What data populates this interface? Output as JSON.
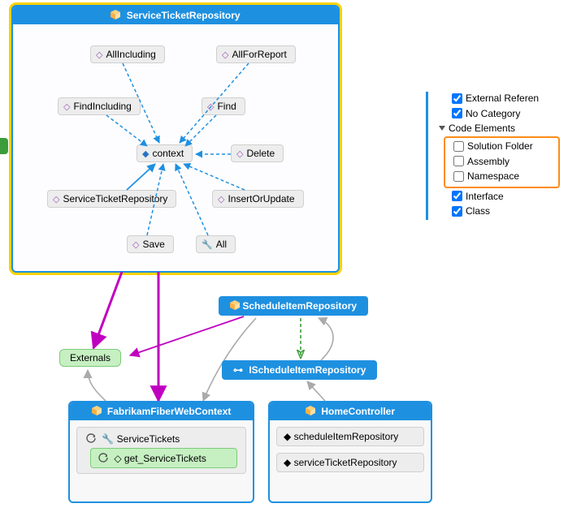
{
  "repo_main": {
    "title": "ServiceTicketRepository",
    "nodes": {
      "allIncluding": "AllIncluding",
      "allForReport": "AllForReport",
      "findIncluding": "FindIncluding",
      "find": "Find",
      "context": "context",
      "delete": "Delete",
      "serviceTicketRepository": "ServiceTicketRepository",
      "insertOrUpdate": "InsertOrUpdate",
      "save": "Save",
      "all": "All"
    }
  },
  "externals": "Externals",
  "schedule_repo": "ScheduleItemRepository",
  "ischedule_repo": "IScheduleItemRepository",
  "fabrikam": {
    "title": "FabrikamFiberWebContext",
    "serviceTickets": "ServiceTickets",
    "getServiceTickets": "get_ServiceTickets"
  },
  "home": {
    "title": "HomeController",
    "scheduleItemRepository": "scheduleItemRepository",
    "serviceTicketRepository": "serviceTicketRepository"
  },
  "legend": {
    "externalReferences": "External Referen",
    "noCategory": "No Category",
    "heading": "Code Elements",
    "solutionFolder": "Solution Folder",
    "assembly": "Assembly",
    "namespace": "Namespace",
    "interface": "Interface",
    "class": "Class"
  },
  "chart_data": {
    "type": "diagram",
    "title": "Code Map / Dependency Graph",
    "nodes": [
      {
        "id": "ServiceTicketRepository",
        "kind": "class-container",
        "selected": true,
        "members": [
          "AllIncluding",
          "AllForReport",
          "FindIncluding",
          "Find",
          "context",
          "Delete",
          "ServiceTicketRepository",
          "InsertOrUpdate",
          "Save",
          "All"
        ]
      },
      {
        "id": "Externals",
        "kind": "external-group"
      },
      {
        "id": "ScheduleItemRepository",
        "kind": "class"
      },
      {
        "id": "IScheduleItemRepository",
        "kind": "interface"
      },
      {
        "id": "FabrikamFiberWebContext",
        "kind": "class-container",
        "members": [
          "ServiceTickets",
          "get_ServiceTickets"
        ]
      },
      {
        "id": "HomeController",
        "kind": "class-container",
        "members": [
          "scheduleItemRepository",
          "serviceTicketRepository"
        ]
      }
    ],
    "edges": [
      {
        "from": "AllIncluding",
        "to": "context",
        "style": "dashed",
        "color": "#1E90E0"
      },
      {
        "from": "AllForReport",
        "to": "context",
        "style": "dashed",
        "color": "#1E90E0"
      },
      {
        "from": "FindIncluding",
        "to": "context",
        "style": "dashed",
        "color": "#1E90E0"
      },
      {
        "from": "Find",
        "to": "context",
        "style": "dashed",
        "color": "#1E90E0"
      },
      {
        "from": "Delete",
        "to": "context",
        "style": "dashed",
        "color": "#1E90E0"
      },
      {
        "from": "ServiceTicketRepository",
        "to": "context",
        "style": "solid",
        "color": "#1E90E0"
      },
      {
        "from": "InsertOrUpdate",
        "to": "context",
        "style": "dashed",
        "color": "#1E90E0"
      },
      {
        "from": "Save",
        "to": "context",
        "style": "dashed",
        "color": "#1E90E0"
      },
      {
        "from": "All",
        "to": "context",
        "style": "dashed",
        "color": "#1E90E0"
      },
      {
        "from": "ServiceTicketRepository",
        "to": "Externals",
        "style": "solid",
        "color": "#C000C0"
      },
      {
        "from": "ServiceTicketRepository",
        "to": "FabrikamFiberWebContext",
        "style": "solid",
        "color": "#C000C0"
      },
      {
        "from": "ScheduleItemRepository",
        "to": "Externals",
        "style": "solid",
        "color": "#C000C0"
      },
      {
        "from": "ScheduleItemRepository",
        "to": "IScheduleItemRepository",
        "style": "dashed",
        "color": "#3A9C3A"
      },
      {
        "from": "IScheduleItemRepository",
        "to": "ScheduleItemRepository",
        "style": "solid",
        "color": "#AAAAAA"
      },
      {
        "from": "FabrikamFiberWebContext",
        "to": "Externals",
        "style": "solid",
        "color": "#AAAAAA"
      },
      {
        "from": "HomeController",
        "to": "IScheduleItemRepository",
        "style": "solid",
        "color": "#AAAAAA"
      },
      {
        "from": "ScheduleItemRepository",
        "to": "FabrikamFiberWebContext",
        "style": "solid",
        "color": "#AAAAAA"
      }
    ],
    "legend_filters": [
      {
        "label": "External Referen",
        "checked": true
      },
      {
        "label": "No Category",
        "checked": true
      },
      {
        "label": "Solution Folder",
        "checked": false,
        "highlighted": true
      },
      {
        "label": "Assembly",
        "checked": false,
        "highlighted": true
      },
      {
        "label": "Namespace",
        "checked": false,
        "highlighted": true
      },
      {
        "label": "Interface",
        "checked": true
      },
      {
        "label": "Class",
        "checked": true
      }
    ]
  }
}
